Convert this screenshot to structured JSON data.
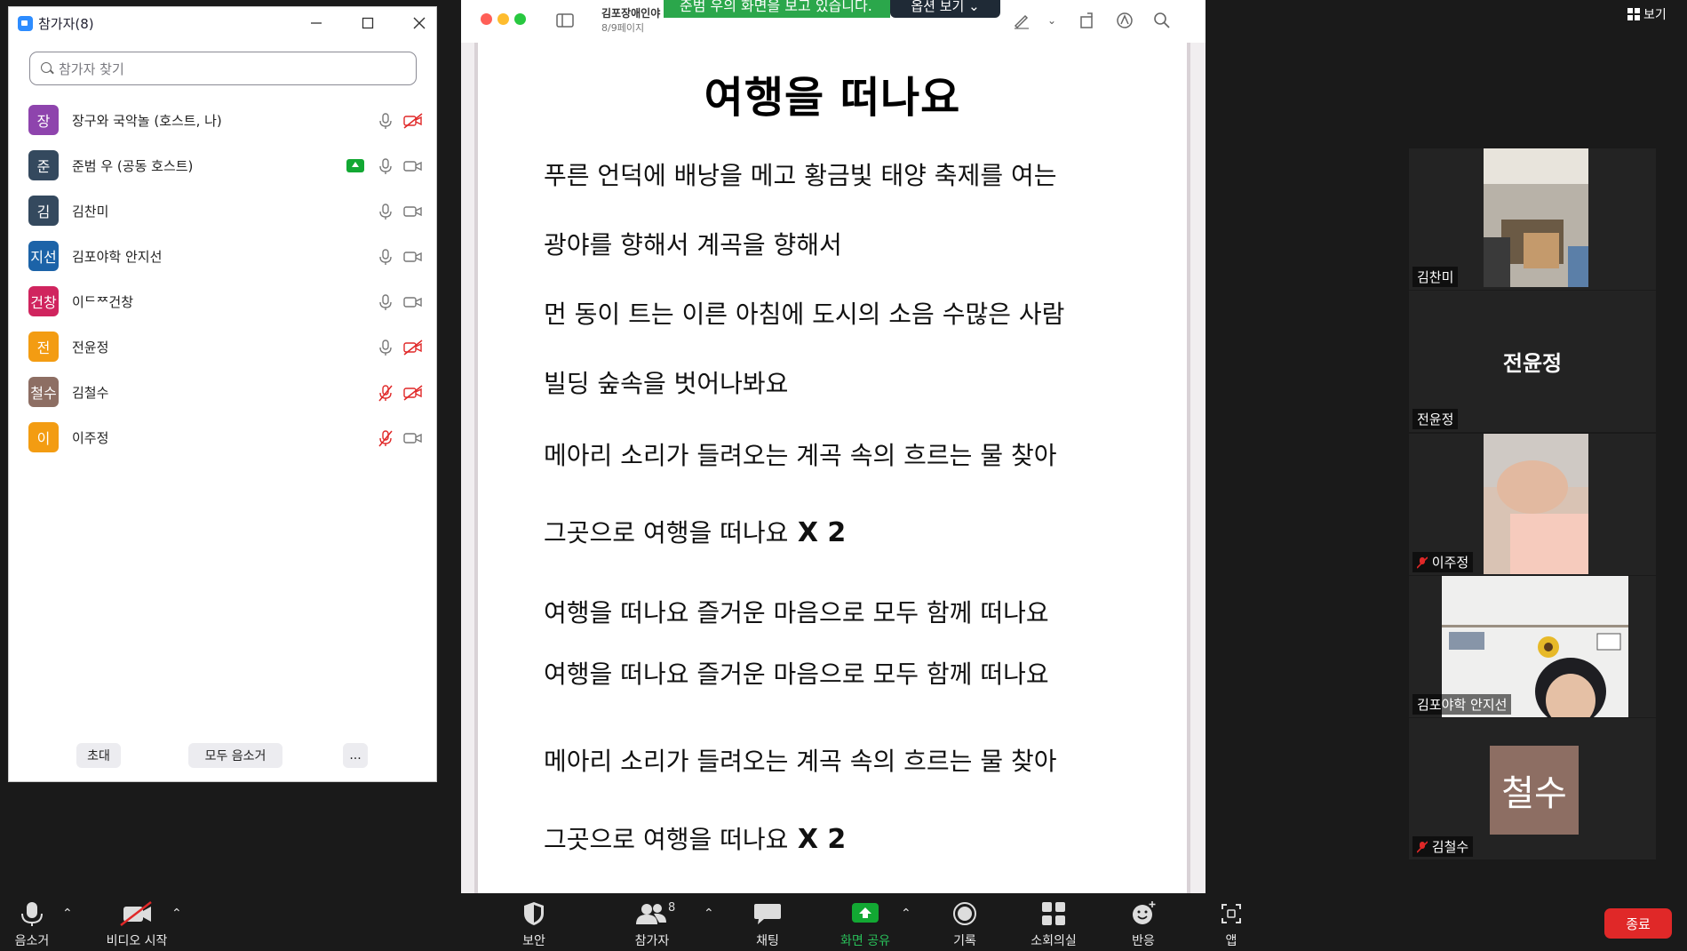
{
  "participants_panel": {
    "title": "참가자(8)",
    "search_placeholder": "참가자 찾기",
    "participants": [
      {
        "avatar_text": "장",
        "avatar_color": "#8e44ad",
        "name": "장구와 국악놀 (호스트, 나)",
        "mic": "on",
        "video": "off",
        "sharing": false
      },
      {
        "avatar_text": "준",
        "avatar_color": "#34495e",
        "name": "준범 우 (공동 호스트)",
        "mic": "on",
        "video": "on",
        "sharing": true
      },
      {
        "avatar_text": "김",
        "avatar_color": "#34495e",
        "name": "김찬미",
        "mic": "on",
        "video": "on",
        "sharing": false
      },
      {
        "avatar_text": "지선",
        "avatar_color": "#1c63a8",
        "name": "김포야학 안지선",
        "mic": "on",
        "video": "on",
        "sharing": false
      },
      {
        "avatar_text": "건창",
        "avatar_color": "#d0245e",
        "name": "이ᄃᄍ건창",
        "mic": "on",
        "video": "on",
        "sharing": false
      },
      {
        "avatar_text": "전",
        "avatar_color": "#f39c12",
        "name": "전윤정",
        "mic": "on",
        "video": "off",
        "sharing": false
      },
      {
        "avatar_text": "철수",
        "avatar_color": "#8d6e63",
        "name": "김철수",
        "mic": "off",
        "video": "off",
        "sharing": false
      },
      {
        "avatar_text": "이",
        "avatar_color": "#f39c12",
        "name": "이주정",
        "mic": "off",
        "video": "on",
        "sharing": false
      }
    ],
    "footer": {
      "invite": "초대",
      "mute_all": "모두 음소거",
      "more": "..."
    }
  },
  "share_banner": {
    "text": "준범 우의 화면을 보고 있습니다.",
    "options": "옵션 보기 ⌄"
  },
  "viewer": {
    "doc_title": "김포장애인야",
    "page_info": "8/9페이지",
    "page_title": "여행을 떠나요",
    "lines": [
      {
        "text": "푸른 언덕에  배낭을 메고  황금빛 태양   축제를 여는",
        "x2": ""
      },
      {
        "text": "광야를 향해서   계곡을 향해서",
        "x2": ""
      },
      {
        "text": "먼 동이 트는   이른 아침에  도시의 소음   수많은 사람",
        "x2": ""
      },
      {
        "text": "빌딩 숲속을  벗어나봐요",
        "x2": ""
      },
      {
        "text": "메아리 소리가 들려오는    계곡 속의 흐르는 물 찾아",
        "x2": ""
      },
      {
        "text": "그곳으로  여행을 떠나요",
        "x2": "X 2"
      },
      {
        "text": "여행을 떠나요  즐거운 마음으로 모두 함께 떠나요",
        "x2": ""
      },
      {
        "text": "여행을 떠나요  즐거운 마음으로 모두 함께 떠나요",
        "x2": ""
      },
      {
        "text": "메아리 소리가 들려오는    계곡 속의 흐르는 물 찾아",
        "x2": ""
      },
      {
        "text": "그곳으로  여행을 떠나요",
        "x2": "X 2"
      }
    ]
  },
  "view_button": "보기",
  "video_tiles": [
    {
      "name": "김찬미",
      "muted": false,
      "has_video": true
    },
    {
      "name": "전윤정",
      "muted": false,
      "has_video": false
    },
    {
      "name": "이주정",
      "muted": true,
      "has_video": true
    },
    {
      "name": "김포야학 안지선",
      "muted": false,
      "has_video": true
    },
    {
      "name": "김철수",
      "muted": true,
      "has_video": false,
      "avatar_text": "철수",
      "avatar_color": "#8d6e63"
    }
  ],
  "toolbar": {
    "mute": "음소거",
    "start_video": "비디오 시작",
    "security": "보안",
    "participants": "참가자",
    "participants_count": "8",
    "chat": "채팅",
    "share_screen": "화면 공유",
    "record": "기록",
    "breakout": "소회의실",
    "reactions": "반응",
    "apps": "앱",
    "end": "종료"
  }
}
